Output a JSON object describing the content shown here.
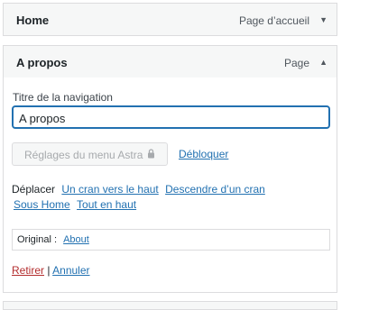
{
  "items": [
    {
      "title": "Home",
      "type": "Page d’accueil",
      "arrow": "▼"
    },
    {
      "title": "A propos",
      "type": "Page",
      "arrow": "▲",
      "settings": {
        "nav_label_label": "Titre de la navigation",
        "nav_label_value": "A propos",
        "astra_button_label": "Réglages du menu Astra",
        "unlock_link": "Débloquer",
        "move_label": "Déplacer",
        "move_links": {
          "up": "Un cran vers le haut",
          "down": "Descendre d’un cran",
          "under": "Sous Home",
          "top": "Tout en haut"
        },
        "original_label": "Original :",
        "original_link": "About",
        "remove_link": "Retirer",
        "separator": "|",
        "cancel_link": "Annuler"
      }
    }
  ],
  "colors": {
    "accent": "#2271b1",
    "remove": "#b32d2e",
    "border": "#dcdcde",
    "bar_bg": "#f6f7f7"
  }
}
